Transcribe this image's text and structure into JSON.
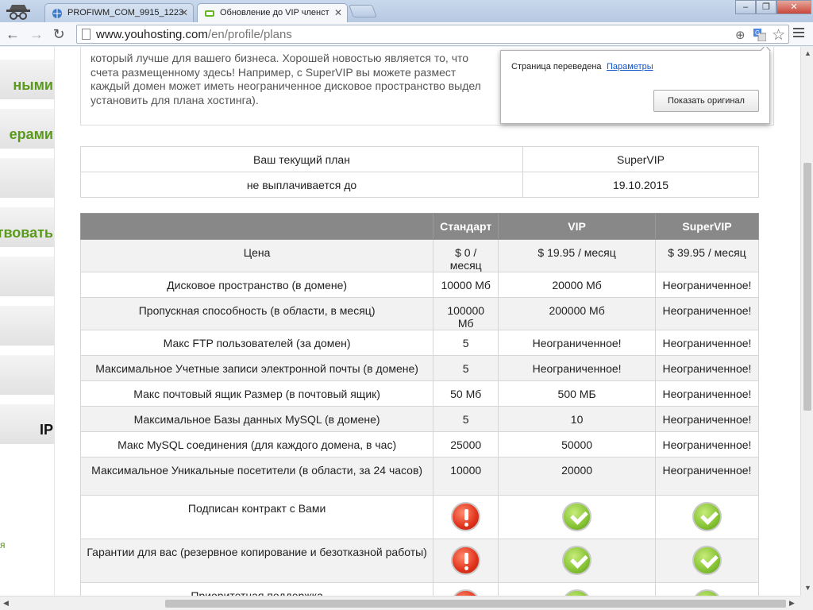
{
  "tabs": [
    {
      "label": "PROFIWM_COM_9915_1223",
      "active": false
    },
    {
      "label": "Обновление до VIP членст",
      "active": true
    }
  ],
  "toolbar": {
    "url_host": "www.youhosting.com",
    "url_path": "/en/profile/plans"
  },
  "sidebar": {
    "items": [
      {
        "label": "ными"
      },
      {
        "label": "ерами"
      },
      {
        "label": ""
      },
      {
        "label": "твовать"
      },
      {
        "label": ""
      },
      {
        "label": ""
      },
      {
        "label": ""
      },
      {
        "label": "IP"
      }
    ],
    "bottom_link": "я"
  },
  "intro": {
    "lines": [
      "который лучше для вашего бизнеса. Хорошей новостью является то, что",
      "счета размещенному здесь! Например, с SuperVIP вы можете размест",
      "каждый домен может иметь неограниченное дисковое пространство выдел",
      "установить для плана хостинга)."
    ]
  },
  "current_plan": {
    "rows": [
      {
        "label": "Ваш текущий план",
        "value": "SuperVIP"
      },
      {
        "label": "не выплачивается до",
        "value": "19.10.2015"
      }
    ]
  },
  "plans": {
    "headers": [
      "",
      "Стандарт",
      "VIP",
      "SuperVIP"
    ],
    "rows": [
      [
        "Цена",
        "$ 0 / месяц",
        "$ 19.95 / месяц",
        "$ 39.95 / месяц"
      ],
      [
        "Дисковое пространство (в домене)",
        "10000 Мб",
        "20000 Мб",
        "Неограниченное!"
      ],
      [
        "Пропускная способность (в области, в месяц)",
        "100000 Мб",
        "200000 Мб",
        "Неограниченное!"
      ],
      [
        "Макс FTP пользователей (за домен)",
        "5",
        "Неограниченное!",
        "Неограниченное!"
      ],
      [
        "Максимальное Учетные записи электронной почты (в домене)",
        "5",
        "Неограниченное!",
        "Неограниченное!"
      ],
      [
        "Макс почтовый ящик Размер (в почтовый ящик)",
        "50 Мб",
        "500 МБ",
        "Неограниченное!"
      ],
      [
        "Максимальное Базы данных MySQL (в домене)",
        "5",
        "10",
        "Неограниченное!"
      ],
      [
        "Макс MySQL соединения (для каждого домена, в час)",
        "25000",
        "50000",
        "Неограниченное!"
      ],
      [
        "Максимальное Уникальные посетители (в области, за 24 часов)",
        "10000",
        "20000",
        "Неограниченное!"
      ]
    ],
    "feature_rows": [
      {
        "label": "Подписан контракт с Вами",
        "standard": "error-icon",
        "vip": "check-icon",
        "supervip": "check-icon"
      },
      {
        "label": "Гарантии для вас (резервное копирование и безотказной работы)",
        "standard": "error-icon",
        "vip": "check-icon",
        "supervip": "check-icon"
      },
      {
        "label": "Приоритетная поддержка",
        "standard": "error-icon",
        "vip": "check-icon",
        "supervip": "check-icon"
      }
    ]
  },
  "translate_popup": {
    "message": "Страница переведена",
    "params_link": "Параметры",
    "show_original_button": "Показать оригинал"
  }
}
